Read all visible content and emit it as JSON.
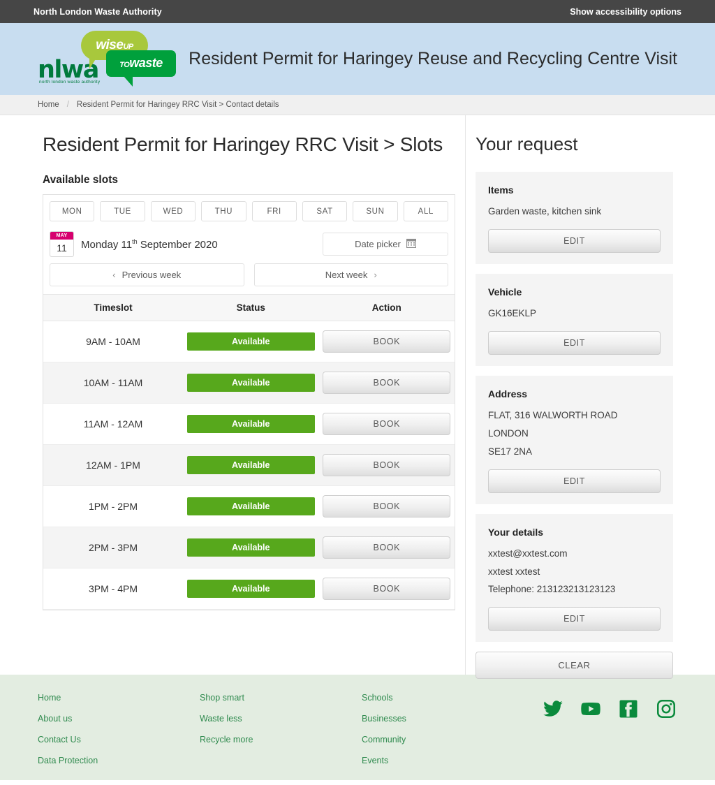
{
  "topbar": {
    "authority": "North London Waste Authority",
    "accessibility": "Show accessibility options"
  },
  "banner": {
    "title": "Resident Permit for Haringey Reuse and Recycling Centre Visit",
    "logo": {
      "wordmark": "nlwa",
      "tagline": "north london waste authority",
      "bubble_1_main": "wise",
      "bubble_1_small": "UP",
      "bubble_2_small": "TO",
      "bubble_2_main": "waste"
    },
    "bg_color": "#c8ddf0"
  },
  "breadcrumb": {
    "home": "Home",
    "separator": "/",
    "current": "Resident Permit for Haringey RRC Visit > Contact details"
  },
  "main": {
    "page_title": "Resident Permit for Haringey RRC Visit > Slots",
    "section_title": "Available slots",
    "day_tabs": [
      "MON",
      "TUE",
      "WED",
      "THU",
      "FRI",
      "SAT",
      "SUN",
      "ALL"
    ],
    "calendar_icon": {
      "month": "MAY",
      "day": "11",
      "accent_color": "#d6006e"
    },
    "selected_date_prefix": "Monday 11",
    "selected_date_sup": "th",
    "selected_date_suffix": " September 2020",
    "date_picker_label": "Date picker",
    "previous_week_label": "Previous week",
    "next_week_label": "Next week",
    "table": {
      "headers": [
        "Timeslot",
        "Status",
        "Action"
      ],
      "rows": [
        {
          "timeslot": "9AM - 10AM",
          "status": "Available",
          "action": "BOOK"
        },
        {
          "timeslot": "10AM - 11AM",
          "status": "Available",
          "action": "BOOK"
        },
        {
          "timeslot": "11AM - 12AM",
          "status": "Available",
          "action": "BOOK"
        },
        {
          "timeslot": "12AM - 1PM",
          "status": "Available",
          "action": "BOOK"
        },
        {
          "timeslot": "1PM - 2PM",
          "status": "Available",
          "action": "BOOK"
        },
        {
          "timeslot": "2PM - 3PM",
          "status": "Available",
          "action": "BOOK"
        },
        {
          "timeslot": "3PM - 4PM",
          "status": "Available",
          "action": "BOOK"
        }
      ],
      "available_color": "#57a81c"
    }
  },
  "sidebar": {
    "title": "Your request",
    "edit_label": "EDIT",
    "clear_label": "CLEAR",
    "cards": [
      {
        "heading": "Items",
        "lines": [
          "Garden waste, kitchen sink"
        ]
      },
      {
        "heading": "Vehicle",
        "lines": [
          "GK16EKLP"
        ]
      },
      {
        "heading": "Address",
        "lines": [
          "FLAT, 316 WALWORTH ROAD",
          "LONDON",
          "SE17 2NA"
        ]
      },
      {
        "heading": "Your details",
        "lines": [
          "xxtest@xxtest.com",
          "xxtest xxtest",
          "Telephone: 213123213123123"
        ]
      }
    ]
  },
  "footer": {
    "columns": [
      [
        "Home",
        "About us",
        "Contact Us",
        "Data Protection"
      ],
      [
        "Shop smart",
        "Waste less",
        "Recycle more"
      ],
      [
        "Schools",
        "Businesses",
        "Community",
        "Events"
      ]
    ],
    "social": [
      "twitter-icon",
      "youtube-icon",
      "facebook-icon",
      "instagram-icon"
    ],
    "link_color": "#2f8a4e",
    "bg_color": "#e3ede1"
  }
}
